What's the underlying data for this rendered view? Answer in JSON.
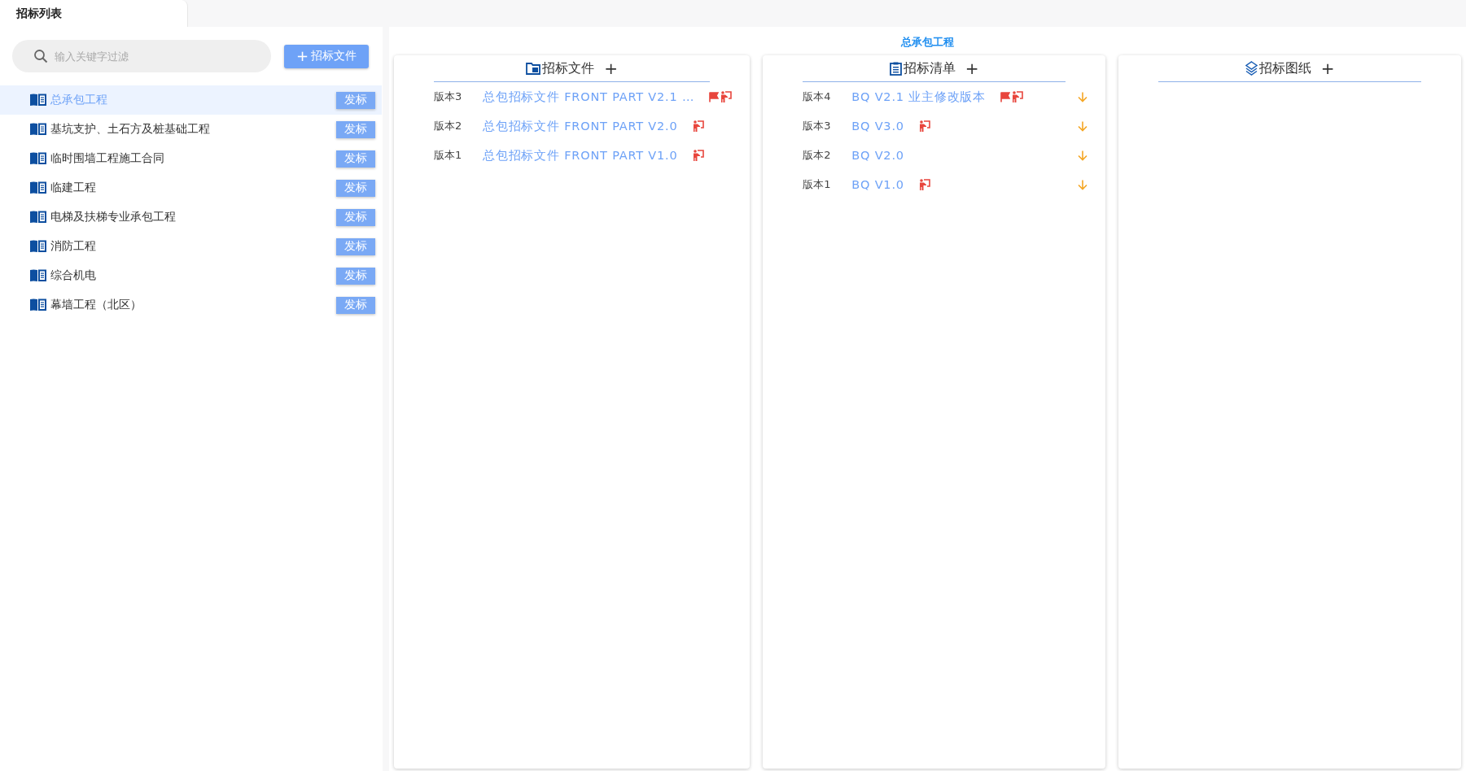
{
  "tab": {
    "label": "招标列表",
    "selected": true
  },
  "search": {
    "placeholder": "输入关键字过滤"
  },
  "add_button": {
    "icon": "+",
    "label": "招标文件"
  },
  "projects": [
    {
      "name": "总承包工程",
      "selected": true,
      "action": "发标"
    },
    {
      "name": "基坑支护、土石方及桩基础工程",
      "selected": false,
      "action": "发标"
    },
    {
      "name": "临时围墙工程施工合同",
      "selected": false,
      "action": "发标"
    },
    {
      "name": "临建工程",
      "selected": false,
      "action": "发标"
    },
    {
      "name": "电梯及扶梯专业承包工程",
      "selected": false,
      "action": "发标"
    },
    {
      "name": "消防工程",
      "selected": false,
      "action": "发标"
    },
    {
      "name": "综合机电",
      "selected": false,
      "action": "发标"
    },
    {
      "name": "幕墙工程（北区）",
      "selected": false,
      "action": "发标"
    }
  ],
  "detail_title": "总承包工程",
  "columns": [
    {
      "kind": "folder",
      "title": "招标文件",
      "add": "+",
      "download": false,
      "versions": [
        {
          "version": "版本3",
          "name": "总包招标文件 FRONT PART V2.1 …",
          "flagged": true,
          "presented": true
        },
        {
          "version": "版本2",
          "name": "总包招标文件 FRONT PART V2.0",
          "flagged": false,
          "presented": true
        },
        {
          "version": "版本1",
          "name": "总包招标文件 FRONT PART V1.0",
          "flagged": false,
          "presented": true
        }
      ]
    },
    {
      "kind": "clipboard",
      "title": "招标清单",
      "add": "+",
      "download": true,
      "versions": [
        {
          "version": "版本4",
          "name": "BQ V2.1 业主修改版本",
          "flagged": true,
          "presented": true
        },
        {
          "version": "版本3",
          "name": "BQ V3.0",
          "flagged": false,
          "presented": true
        },
        {
          "version": "版本2",
          "name": "BQ V2.0",
          "flagged": false,
          "presented": false
        },
        {
          "version": "版本1",
          "name": "BQ V1.0",
          "flagged": false,
          "presented": true
        }
      ]
    },
    {
      "kind": "layers",
      "title": "招标图纸",
      "add": "+"
    }
  ]
}
